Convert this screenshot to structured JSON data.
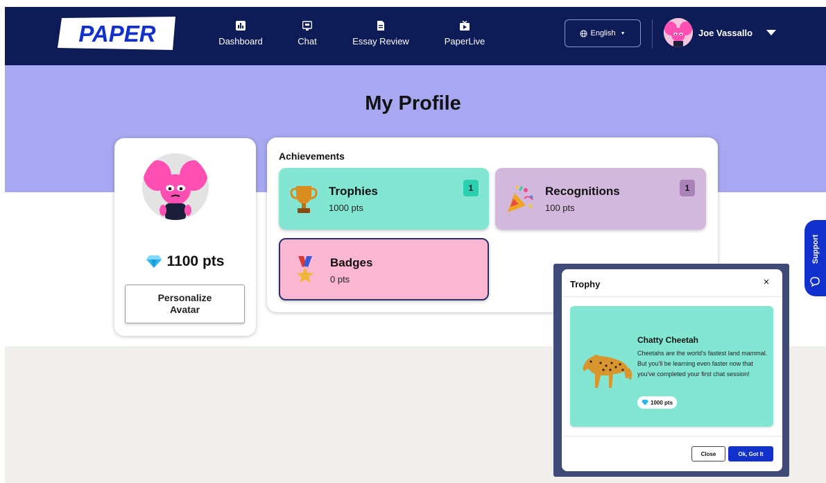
{
  "app": {
    "logo_text": "PAPER",
    "brand_color": "#0d1b57",
    "accent_color": "#1230cc"
  },
  "nav": {
    "items": [
      {
        "label": "Dashboard",
        "icon": "bar-chart-icon"
      },
      {
        "label": "Chat",
        "icon": "chat-screen-icon"
      },
      {
        "label": "Essay Review",
        "icon": "document-icon"
      },
      {
        "label": "PaperLive",
        "icon": "tv-play-icon"
      }
    ],
    "language": {
      "label": "English",
      "icon": "globe-icon"
    },
    "user": {
      "name": "Joe Vassallo",
      "icon": "avatar"
    }
  },
  "page": {
    "title": "My Profile"
  },
  "profile": {
    "points": "1100 pts",
    "points_icon": "diamond-icon",
    "personalize_label": "Personalize\nAvatar"
  },
  "achievements": {
    "title": "Achievements",
    "tiles": [
      {
        "name": "Trophies",
        "points": "1000 pts",
        "count": "1",
        "icon": "trophy-icon",
        "color": "#82e6d3",
        "badge_color": "#2ad0b0"
      },
      {
        "name": "Recognitions",
        "points": "100 pts",
        "count": "1",
        "icon": "party-popper-icon",
        "color": "#d3b8de",
        "badge_color": "#a983b8"
      },
      {
        "name": "Badges",
        "points": "0 pts",
        "icon": "medal-icon",
        "color": "#fbb7d2"
      }
    ]
  },
  "support": {
    "label": "Support",
    "icon": "chat-bubble-icon"
  },
  "modal": {
    "title": "Trophy",
    "close_symbol": "×",
    "award": {
      "name": "Chatty Cheetah",
      "description": "Cheetahs are the world's fastest land mammal. But you'll be learning even faster now that you've completed your first chat session!",
      "points": "1000 pts",
      "icon": "cheetah-icon"
    },
    "buttons": {
      "close": "Close",
      "ok": "Ok, Got It"
    }
  }
}
